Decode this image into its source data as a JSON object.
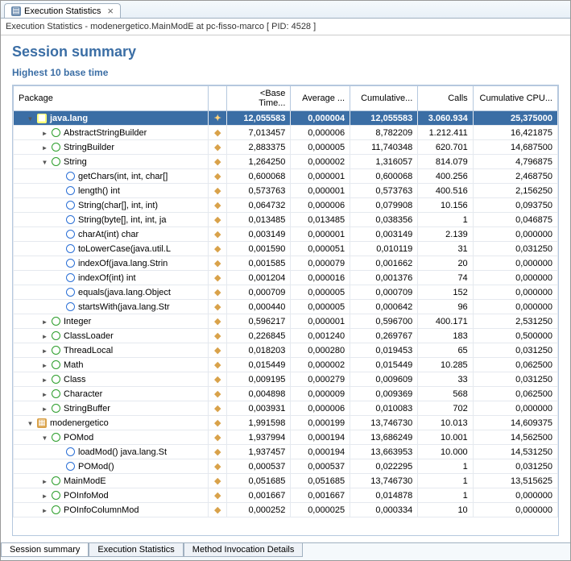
{
  "tab": {
    "title": "Execution Statistics"
  },
  "breadcrumb": "Execution Statistics - modenergetico.MainModE at pc-fisso-marco [ PID: 4528 ]",
  "title": "Session summary",
  "subtitle": "Highest 10 base time",
  "cols": [
    "Package",
    "<Base Time...",
    "Average ...",
    "Cumulative...",
    "Calls",
    "Cumulative CPU..."
  ],
  "rows": [
    {
      "d": 0,
      "t": "e",
      "i": "pkg",
      "n": "java.lang",
      "sel": true,
      "b": "12,055583",
      "a": "0,000004",
      "c": "12,055583",
      "k": "3.060.934",
      "u": "25,375000"
    },
    {
      "d": 1,
      "t": "c",
      "i": "class",
      "n": "AbstractStringBuilder",
      "b": "7,013457",
      "a": "0,000006",
      "c": "8,782209",
      "k": "1.212.411",
      "u": "16,421875"
    },
    {
      "d": 1,
      "t": "c",
      "i": "class",
      "n": "StringBuilder",
      "b": "2,883375",
      "a": "0,000005",
      "c": "11,740348",
      "k": "620.701",
      "u": "14,687500"
    },
    {
      "d": 1,
      "t": "e",
      "i": "class",
      "n": "String",
      "b": "1,264250",
      "a": "0,000002",
      "c": "1,316057",
      "k": "814.079",
      "u": "4,796875"
    },
    {
      "d": 2,
      "t": "",
      "i": "method",
      "n": "getChars(int, int, char[]",
      "b": "0,600068",
      "a": "0,000001",
      "c": "0,600068",
      "k": "400.256",
      "u": "2,468750"
    },
    {
      "d": 2,
      "t": "",
      "i": "method",
      "n": "length() int",
      "b": "0,573763",
      "a": "0,000001",
      "c": "0,573763",
      "k": "400.516",
      "u": "2,156250"
    },
    {
      "d": 2,
      "t": "",
      "i": "method",
      "n": "String(char[], int, int)",
      "b": "0,064732",
      "a": "0,000006",
      "c": "0,079908",
      "k": "10.156",
      "u": "0,093750"
    },
    {
      "d": 2,
      "t": "",
      "i": "method",
      "n": "String(byte[], int, int, ja",
      "b": "0,013485",
      "a": "0,013485",
      "c": "0,038356",
      "k": "1",
      "u": "0,046875"
    },
    {
      "d": 2,
      "t": "",
      "i": "method",
      "n": "charAt(int) char",
      "b": "0,003149",
      "a": "0,000001",
      "c": "0,003149",
      "k": "2.139",
      "u": "0,000000"
    },
    {
      "d": 2,
      "t": "",
      "i": "method",
      "n": "toLowerCase(java.util.L",
      "b": "0,001590",
      "a": "0,000051",
      "c": "0,010119",
      "k": "31",
      "u": "0,031250"
    },
    {
      "d": 2,
      "t": "",
      "i": "method",
      "n": "indexOf(java.lang.Strin",
      "b": "0,001585",
      "a": "0,000079",
      "c": "0,001662",
      "k": "20",
      "u": "0,000000"
    },
    {
      "d": 2,
      "t": "",
      "i": "method",
      "n": "indexOf(int) int",
      "b": "0,001204",
      "a": "0,000016",
      "c": "0,001376",
      "k": "74",
      "u": "0,000000"
    },
    {
      "d": 2,
      "t": "",
      "i": "method",
      "n": "equals(java.lang.Object",
      "b": "0,000709",
      "a": "0,000005",
      "c": "0,000709",
      "k": "152",
      "u": "0,000000"
    },
    {
      "d": 2,
      "t": "",
      "i": "method",
      "n": "startsWith(java.lang.Str",
      "b": "0,000440",
      "a": "0,000005",
      "c": "0,000642",
      "k": "96",
      "u": "0,000000"
    },
    {
      "d": 1,
      "t": "c",
      "i": "class",
      "n": "Integer",
      "b": "0,596217",
      "a": "0,000001",
      "c": "0,596700",
      "k": "400.171",
      "u": "2,531250"
    },
    {
      "d": 1,
      "t": "c",
      "i": "class",
      "n": "ClassLoader",
      "b": "0,226845",
      "a": "0,001240",
      "c": "0,269767",
      "k": "183",
      "u": "0,500000"
    },
    {
      "d": 1,
      "t": "c",
      "i": "class",
      "n": "ThreadLocal",
      "b": "0,018203",
      "a": "0,000280",
      "c": "0,019453",
      "k": "65",
      "u": "0,031250"
    },
    {
      "d": 1,
      "t": "c",
      "i": "class",
      "n": "Math",
      "b": "0,015449",
      "a": "0,000002",
      "c": "0,015449",
      "k": "10.285",
      "u": "0,062500"
    },
    {
      "d": 1,
      "t": "c",
      "i": "class",
      "n": "Class",
      "b": "0,009195",
      "a": "0,000279",
      "c": "0,009609",
      "k": "33",
      "u": "0,031250"
    },
    {
      "d": 1,
      "t": "c",
      "i": "class",
      "n": "Character",
      "b": "0,004898",
      "a": "0,000009",
      "c": "0,009369",
      "k": "568",
      "u": "0,062500"
    },
    {
      "d": 1,
      "t": "c",
      "i": "class",
      "n": "StringBuffer",
      "b": "0,003931",
      "a": "0,000006",
      "c": "0,010083",
      "k": "702",
      "u": "0,000000"
    },
    {
      "d": 0,
      "t": "e",
      "i": "pkg",
      "n": "modenergetico",
      "b": "1,991598",
      "a": "0,000199",
      "c": "13,746730",
      "k": "10.013",
      "u": "14,609375"
    },
    {
      "d": 1,
      "t": "e",
      "i": "class",
      "n": "POMod",
      "b": "1,937994",
      "a": "0,000194",
      "c": "13,686249",
      "k": "10.001",
      "u": "14,562500"
    },
    {
      "d": 2,
      "t": "",
      "i": "method",
      "n": "loadMod() java.lang.St",
      "b": "1,937457",
      "a": "0,000194",
      "c": "13,663953",
      "k": "10.000",
      "u": "14,531250"
    },
    {
      "d": 2,
      "t": "",
      "i": "method",
      "n": "POMod()",
      "b": "0,000537",
      "a": "0,000537",
      "c": "0,022295",
      "k": "1",
      "u": "0,031250"
    },
    {
      "d": 1,
      "t": "c",
      "i": "class",
      "n": "MainModE",
      "b": "0,051685",
      "a": "0,051685",
      "c": "13,746730",
      "k": "1",
      "u": "13,515625"
    },
    {
      "d": 1,
      "t": "c",
      "i": "class",
      "n": "POInfoMod",
      "b": "0,001667",
      "a": "0,001667",
      "c": "0,014878",
      "k": "1",
      "u": "0,000000"
    },
    {
      "d": 1,
      "t": "c",
      "i": "class",
      "n": "POInfoColumnMod",
      "b": "0,000252",
      "a": "0,000025",
      "c": "0,000334",
      "k": "10",
      "u": "0,000000"
    }
  ],
  "bottomTabs": [
    "Session summary",
    "Execution Statistics",
    "Method Invocation Details"
  ]
}
